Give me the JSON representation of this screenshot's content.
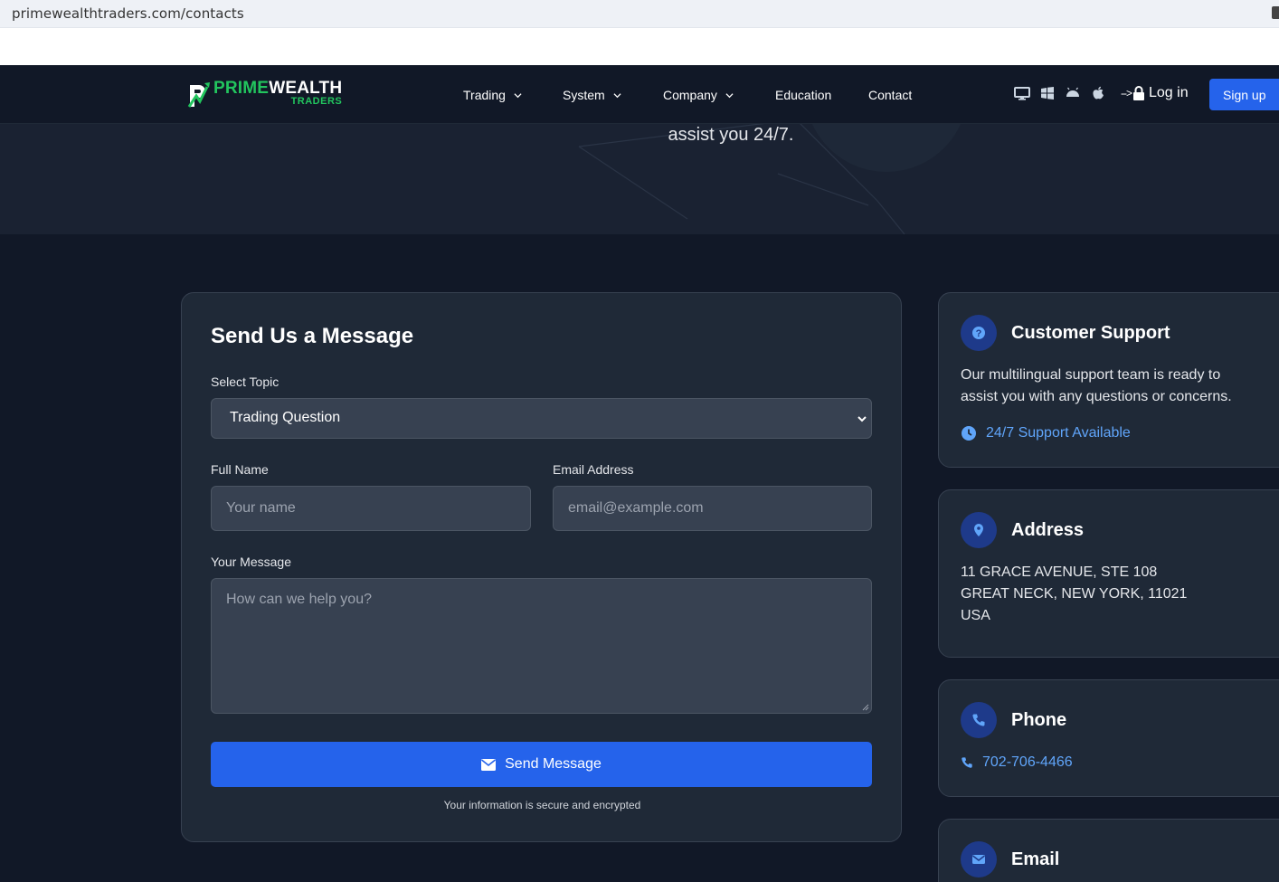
{
  "browser": {
    "url": "primewealthtraders.com/contacts"
  },
  "logo": {
    "prime": "PRIME",
    "wealth": "WEALTH",
    "traders": "TRADERS"
  },
  "nav": {
    "items": [
      {
        "label": "Trading"
      },
      {
        "label": "System"
      },
      {
        "label": "Company"
      },
      {
        "label": "Education"
      },
      {
        "label": "Contact"
      }
    ],
    "platform_icons": [
      "desktop-icon",
      "windows-icon",
      "android-icon",
      "apple-icon"
    ],
    "login_arrow": "-->",
    "login_label": "Log in",
    "signup_label": "Sign up"
  },
  "hero": {
    "tagline": "assist you 24/7."
  },
  "form": {
    "title": "Send Us a Message",
    "topic_label": "Select Topic",
    "topic_value": "Trading Question",
    "name_label": "Full Name",
    "name_placeholder": "Your name",
    "email_label": "Email Address",
    "email_placeholder": "email@example.com",
    "message_label": "Your Message",
    "message_placeholder": "How can we help you?",
    "send_label": "Send Message",
    "secure_note": "Your information is secure and encrypted"
  },
  "support": {
    "title": "Customer Support",
    "text_line1": "Our multilingual support team is ready to",
    "text_line2": "assist you with any questions or concerns.",
    "availability": "24/7 Support Available"
  },
  "address": {
    "title": "Address",
    "line1": "11 GRACE AVENUE, STE 108",
    "line2": "GREAT NECK, NEW YORK, 11021",
    "line3": "USA"
  },
  "phone": {
    "title": "Phone",
    "number": "702-706-4466"
  },
  "email": {
    "title": "Email"
  },
  "colors": {
    "accent": "#2563eb",
    "brand_green": "#22c55e",
    "link": "#60a5fa",
    "background": "#111827",
    "card": "#1f2937"
  }
}
